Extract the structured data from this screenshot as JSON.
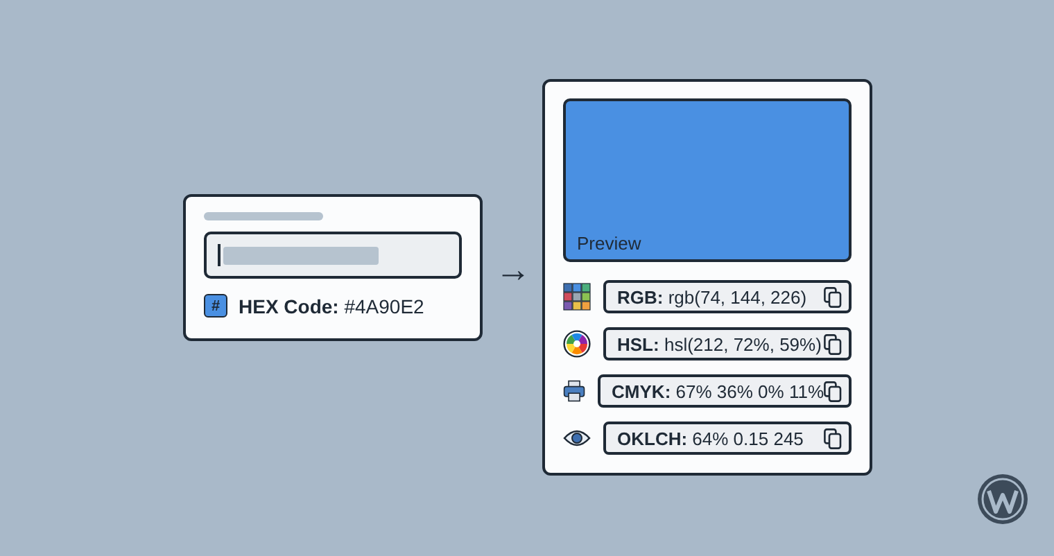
{
  "input_card": {
    "badge": "#",
    "label": "HEX Code:",
    "value": "#4A90E2"
  },
  "arrow": "→",
  "result_card": {
    "preview": {
      "label": "Preview",
      "color": "#4a90e2"
    },
    "formats": [
      {
        "kind": "grid",
        "label": "RGB:",
        "value": "rgb(74, 144, 226)"
      },
      {
        "kind": "wheel",
        "label": "HSL:",
        "value": "hsl(212, 72%, 59%)"
      },
      {
        "kind": "printer",
        "label": "CMYK:",
        "value": "67% 36% 0% 11%"
      },
      {
        "kind": "eye",
        "label": "OKLCH:",
        "value": "64% 0.15 245"
      }
    ]
  }
}
